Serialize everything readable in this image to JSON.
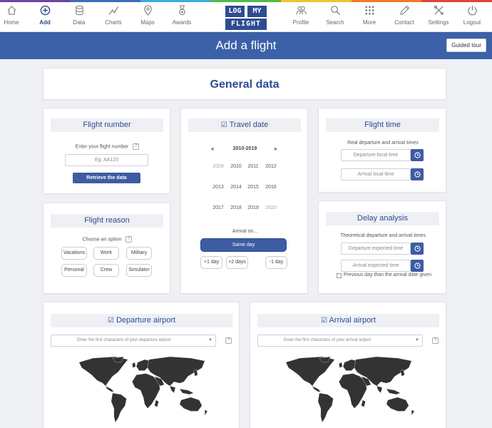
{
  "rainbow": [
    "#6f42a8",
    "#3f6cc4",
    "#3fa9e0",
    "#57b848",
    "#f2c230",
    "#f07a2c",
    "#e0443c"
  ],
  "nav": {
    "items": [
      {
        "label": "Home",
        "icon": "home-icon"
      },
      {
        "label": "Add",
        "icon": "plus-circle-icon"
      },
      {
        "label": "Data",
        "icon": "database-icon"
      },
      {
        "label": "Charts",
        "icon": "chart-icon"
      },
      {
        "label": "Maps",
        "icon": "map-pin-icon"
      },
      {
        "label": "Awards",
        "icon": "medal-icon"
      },
      {
        "label": "Profile",
        "icon": "users-icon"
      },
      {
        "label": "Search",
        "icon": "search-icon"
      },
      {
        "label": "More",
        "icon": "grid-icon"
      },
      {
        "label": "Contact",
        "icon": "pencil-icon"
      },
      {
        "label": "Settings",
        "icon": "tools-icon"
      },
      {
        "label": "Logout",
        "icon": "power-icon"
      }
    ],
    "active": "Add",
    "logo_top": [
      "LOG",
      "MY"
    ],
    "logo_bottom": "FLIGHT"
  },
  "header": {
    "title": "Add a flight",
    "tour_button": "Guided tour"
  },
  "general": {
    "title": "General data"
  },
  "flight_number": {
    "title": "Flight number",
    "label": "Enter your flight number",
    "placeholder": "Eg: AA123",
    "retrieve_button": "Retrieve the data"
  },
  "flight_reason": {
    "title": "Flight reason",
    "label": "Choose an option",
    "options": [
      "Vacations",
      "Work",
      "Military",
      "Personal",
      "Crew",
      "Simulator"
    ]
  },
  "travel_date": {
    "title": "Travel date",
    "prev": "«",
    "next": "»",
    "range": "2010-2019",
    "years": [
      "2009",
      "2010",
      "2011",
      "2012",
      "2013",
      "2014",
      "2015",
      "2016",
      "2017",
      "2018",
      "2019",
      "2020"
    ],
    "muted_years": [
      "2009",
      "2020"
    ],
    "arrival_label": "Arrival on...",
    "same_day": "Same day",
    "plus1": "+1 day",
    "plus2": "+2 days",
    "minus1": "-1 day"
  },
  "flight_time": {
    "title": "Flight time",
    "label": "Real departure and arrival times",
    "departure_placeholder": "Departure local time",
    "arrival_placeholder": "Arrival local time"
  },
  "delay": {
    "title": "Delay analysis",
    "label": "Theoretical departure and arrival times",
    "departure_placeholder": "Departure expected time",
    "arrival_placeholder": "Arrival expected time",
    "previous_day_label": "Previous day than the arrival date given"
  },
  "departure_airport": {
    "title": "Departure airport",
    "placeholder": "Enter the first characters of your departure airport"
  },
  "arrival_airport": {
    "title": "Arrival airport",
    "placeholder": "Enter the first characters of your arrival airport"
  },
  "colors": {
    "brand": "#3c61a8",
    "accent_dark": "#2c4b92",
    "map": "#333333"
  }
}
